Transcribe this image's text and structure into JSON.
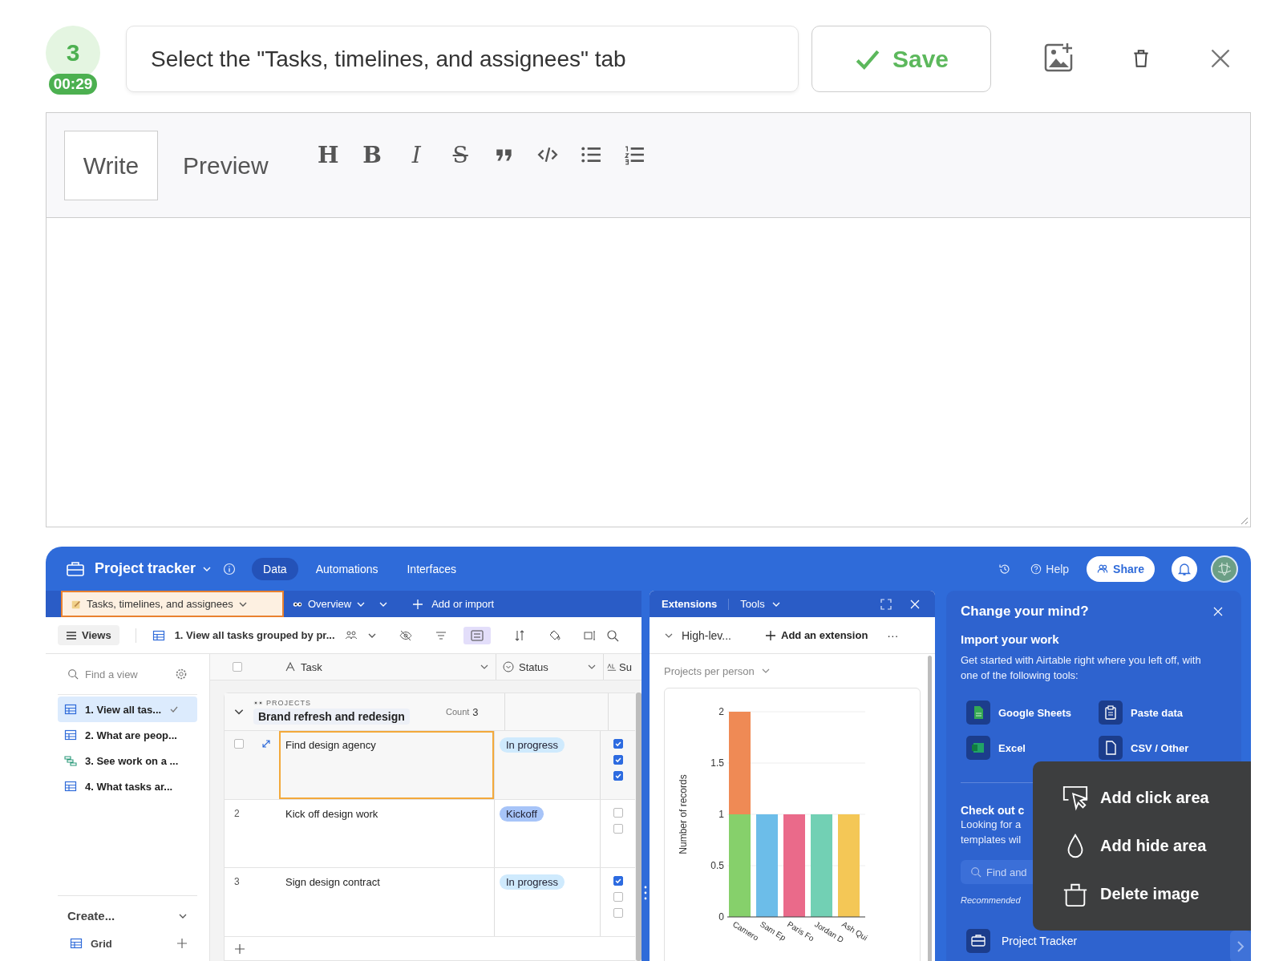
{
  "prompt": {
    "step": "3",
    "timer": "00:29",
    "instruction": "Select the \"Tasks, timelines, and assignees\" tab",
    "save": "Save"
  },
  "editor": {
    "tabs": [
      {
        "label": "Write",
        "selected": true
      },
      {
        "label": "Preview",
        "selected": false
      }
    ],
    "tools": [
      {
        "kind": "heading",
        "label": "H"
      },
      {
        "kind": "bold",
        "label": "B"
      },
      {
        "kind": "italic",
        "label": "I"
      },
      {
        "kind": "strike",
        "label": "S"
      },
      {
        "kind": "quote"
      },
      {
        "kind": "code"
      },
      {
        "kind": "bullets"
      },
      {
        "kind": "numbers"
      }
    ]
  },
  "app": {
    "base_name": "Project tracker",
    "nav": [
      {
        "label": "Data",
        "selected": true
      },
      {
        "label": "Automations",
        "selected": false
      },
      {
        "label": "Interfaces",
        "selected": false
      }
    ],
    "help": "Help",
    "share": "Share",
    "table_tabs": [
      {
        "label": "Tasks, timelines, and assignees",
        "selected": true
      },
      {
        "label": "Overview",
        "selected": false
      }
    ],
    "add_import": "Add or import",
    "views_button": "Views",
    "current_view": "1. View all tasks grouped by pr...",
    "find_view_placeholder": "Find a view",
    "views": [
      {
        "label": "1. View all tas...",
        "kind": "grid",
        "selected": true
      },
      {
        "label": "2. What are peop...",
        "kind": "grid",
        "selected": false
      },
      {
        "label": "3. See work on a ...",
        "kind": "timeline",
        "selected": false
      },
      {
        "label": "4. What tasks ar...",
        "kind": "grid",
        "selected": false
      }
    ],
    "create": "Create...",
    "create_grid": "Grid",
    "select_all": {
      "checked": false
    },
    "columns": [
      "Task",
      "Status",
      "Su"
    ],
    "group": {
      "label": "PROJECTS",
      "name": "Brand refresh and redesign",
      "count_label": "Count",
      "count": "3"
    },
    "rows": [
      {
        "selected": true,
        "row_checked": false,
        "task": "Find design agency",
        "status": {
          "label": "In progress",
          "color": "#cfeafd"
        },
        "checks": [
          true,
          true,
          true
        ]
      },
      {
        "selected": false,
        "number": "2",
        "task": "Kick off design work",
        "status": {
          "label": "Kickoff",
          "color": "#a7c4f8"
        },
        "checks": [
          false,
          false
        ]
      },
      {
        "selected": false,
        "number": "3",
        "task": "Sign design contract",
        "status": {
          "label": "In progress",
          "color": "#cfeafd"
        },
        "checks": [
          true,
          false,
          false
        ]
      }
    ]
  },
  "extensions": {
    "title": "Extensions",
    "tools": "Tools",
    "extension_name": "High-lev...",
    "add_extension": "Add an extension",
    "more": "···",
    "chart_data": {
      "type": "bar",
      "title": "Projects per person",
      "ylabel": "Number of records",
      "categories": [
        "Camero",
        "Sam Ep",
        "Paris Fo",
        "Jordan D",
        "Ash Qui"
      ],
      "series": [
        {
          "color": "#86d06b",
          "values": [
            1,
            null,
            null,
            null,
            null
          ]
        },
        {
          "color": "#ef8a55",
          "values": [
            1,
            null,
            null,
            null,
            null
          ]
        },
        {
          "color": "#6cbde9",
          "values": [
            null,
            1,
            null,
            null,
            null
          ]
        },
        {
          "color": "#ea6a8a",
          "values": [
            null,
            null,
            1,
            null,
            null
          ]
        },
        {
          "color": "#72d0b4",
          "values": [
            null,
            null,
            null,
            1,
            null
          ]
        },
        {
          "color": "#f4c756",
          "values": [
            null,
            null,
            null,
            null,
            1
          ]
        }
      ],
      "ylim": [
        0,
        2
      ],
      "yticks": [
        0,
        0.5,
        1,
        1.5,
        2
      ],
      "grid": true,
      "stacked": true
    }
  },
  "import_panel": {
    "title": "Change your mind?",
    "subtitle": "Import your work",
    "text": "Get started with Airtable right where you left off, with one of the following tools:",
    "tools": [
      {
        "label": "Google Sheets",
        "kind": "sheets"
      },
      {
        "label": "Paste data",
        "kind": "paste"
      },
      {
        "label": "Excel",
        "kind": "excel"
      },
      {
        "label": "CSV / Other",
        "kind": "file"
      }
    ],
    "check_out": "Check out c",
    "looking": [
      "Looking for a",
      "templates wil"
    ],
    "search_placeholder": "Find and",
    "recommended": "Recommended",
    "recommended_item": "Project Tracker"
  },
  "context_menu": [
    {
      "kind": "click",
      "label": "Add click area"
    },
    {
      "kind": "hide",
      "label": "Add hide area"
    },
    {
      "kind": "delete",
      "label": "Delete image"
    }
  ]
}
